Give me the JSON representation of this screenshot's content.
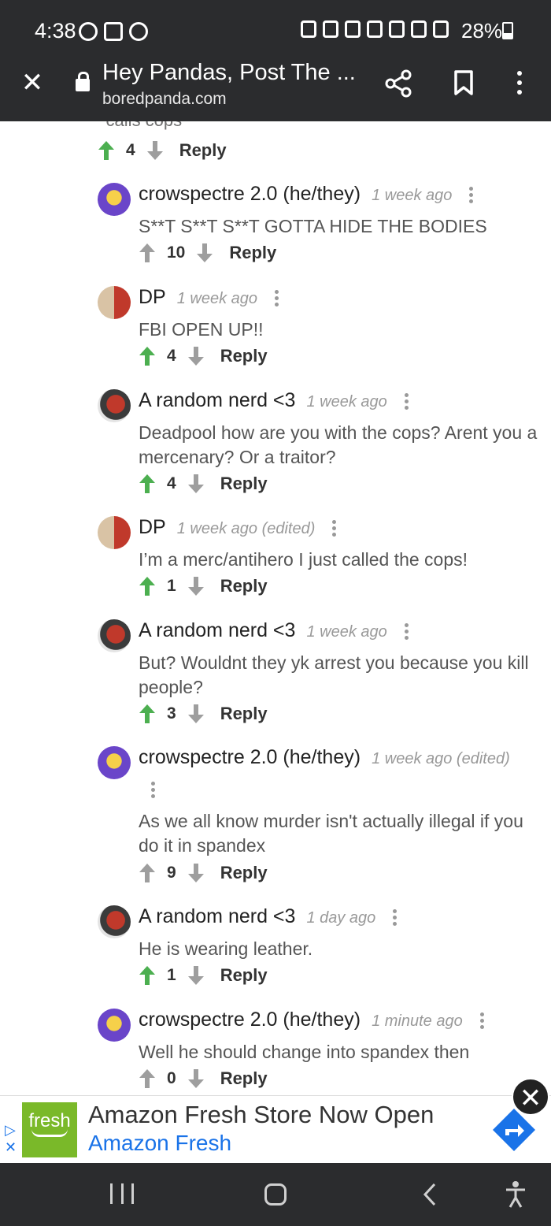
{
  "status_bar": {
    "time": "4:38",
    "battery": "28%"
  },
  "browser": {
    "title": "Hey Pandas, Post The ...",
    "url": "boredpanda.com"
  },
  "clipped_text": "*calls cops*",
  "top_votes": {
    "count": "4",
    "reply": "Reply"
  },
  "comments": [
    {
      "author": "crowspectre 2.0 (he/they)",
      "time": "1 week ago",
      "text": "S**T S**T S**T GOTTA HIDE THE BODIES",
      "votes": "10",
      "upvoted": false,
      "reply": "Reply"
    },
    {
      "author": "DP",
      "time": "1 week ago",
      "text": "FBI OPEN UP!!",
      "votes": "4",
      "upvoted": true,
      "reply": "Reply"
    },
    {
      "author": "A random nerd <3",
      "time": "1 week ago",
      "text": "Deadpool how are you with the cops? Arent you a mercenary? Or a traitor?",
      "votes": "4",
      "upvoted": true,
      "reply": "Reply"
    },
    {
      "author": "DP",
      "time": "1 week ago (edited)",
      "text": "I’m a merc/antihero I just called the cops!",
      "votes": "1",
      "upvoted": true,
      "reply": "Reply"
    },
    {
      "author": "A random nerd <3",
      "time": "1 week ago",
      "text": "But? Wouldnt they yk arrest you because you kill people?",
      "votes": "3",
      "upvoted": true,
      "reply": "Reply"
    },
    {
      "author": "crowspectre 2.0 (he/they)",
      "time": "1 week ago (edited)",
      "text": "As we all know murder isn't actually illegal if you do it in spandex",
      "votes": "9",
      "upvoted": false,
      "reply": "Reply"
    },
    {
      "author": "A random nerd <3",
      "time": "1 day ago",
      "text": "He is wearing leather.",
      "votes": "1",
      "upvoted": true,
      "reply": "Reply"
    },
    {
      "author": "crowspectre 2.0 (he/they)",
      "time": "1 minute ago",
      "text": "Well he should change into spandex then",
      "votes": "0",
      "upvoted": false,
      "reply": "Reply"
    }
  ],
  "ad": {
    "logo_text": "fresh",
    "title": "Amazon Fresh Store Now Open",
    "advertiser": "Amazon Fresh"
  },
  "colors": {
    "upvote_active": "#4caf50",
    "vote_inactive": "#9e9e9e",
    "bar_bg": "#2b2c2e",
    "ad_link": "#1a73e8"
  }
}
